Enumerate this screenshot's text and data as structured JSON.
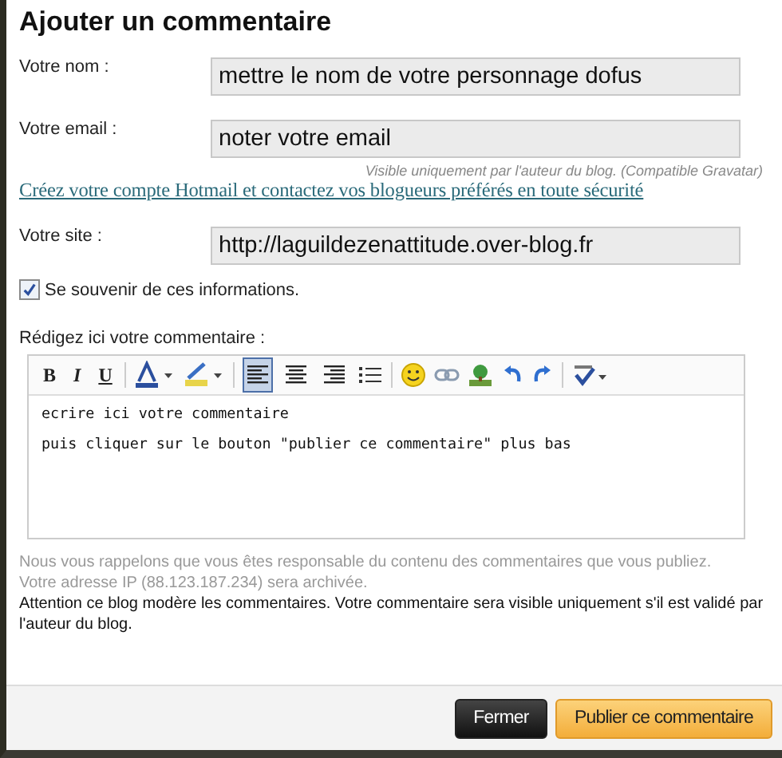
{
  "title": "Ajouter un commentaire",
  "fields": [
    {
      "label": "Votre nom :",
      "value": "mettre le nom de votre personnage dofus"
    },
    {
      "label": "Votre email :",
      "value": "noter votre email",
      "hint": "Visible uniquement par l'auteur du blog. (Compatible Gravatar)",
      "link": "Créez votre compte Hotmail et contactez vos blogueurs préférés en toute sécurité"
    },
    {
      "label": "Votre site :",
      "value": "http://laguildezenattitude.over-blog.fr"
    }
  ],
  "remember": {
    "label": "Se souvenir de ces informations.",
    "checked": true
  },
  "editor": {
    "label": "Rédigez ici votre commentaire :",
    "format_buttons": [
      "B",
      "I",
      "U"
    ],
    "alignment": [
      {
        "selected": true
      },
      {
        "selected": false
      },
      {
        "selected": false
      }
    ],
    "lines": [
      "ecrire ici votre commentaire",
      "puis cliquer sur le bouton \"publier ce commentaire\" plus bas"
    ]
  },
  "notes": [
    "Nous vous rappelons que vous êtes responsable du contenu des commentaires que vous publiez.",
    "Votre adresse IP (88.123.187.234) sera archivée."
  ],
  "moderation": "Attention ce blog modère les commentaires. Votre commentaire sera visible uniquement s'il est validé par l'auteur du blog.",
  "buttons": [
    {
      "label": "Fermer",
      "kind": "secondary"
    },
    {
      "label": "Publier ce commentaire",
      "kind": "primary"
    }
  ]
}
